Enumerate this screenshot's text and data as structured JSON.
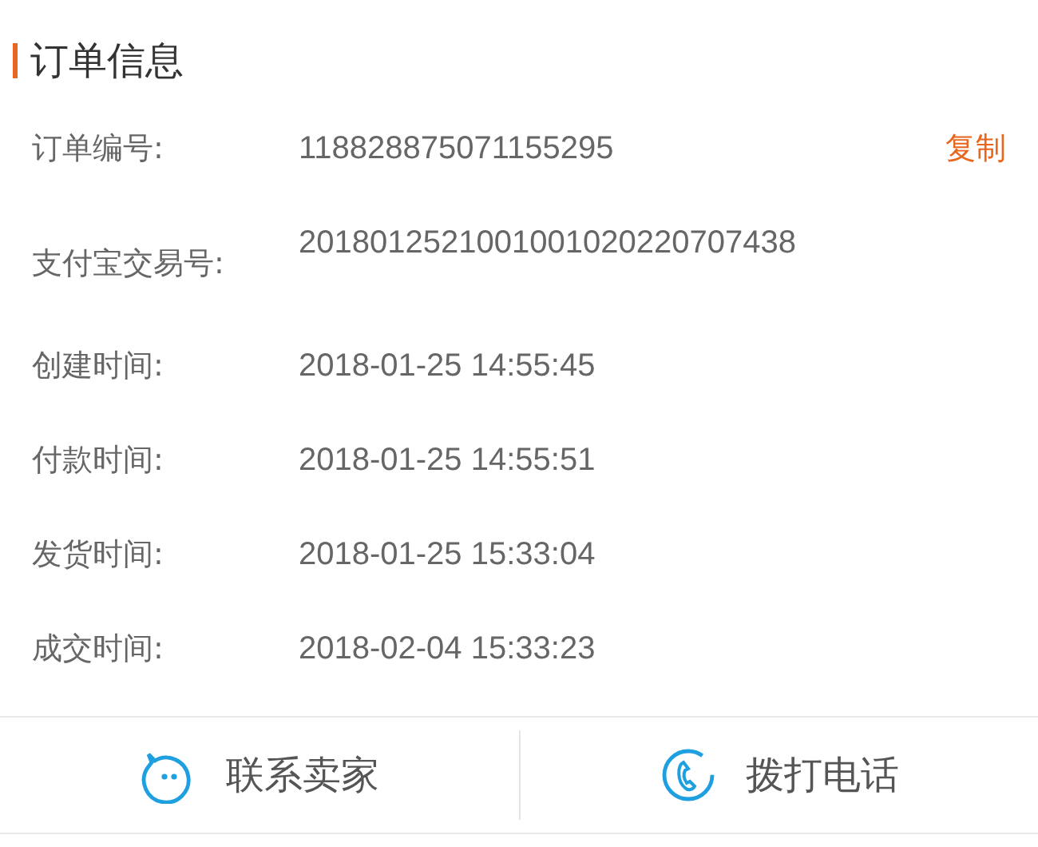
{
  "section": {
    "title": "订单信息"
  },
  "fields": [
    {
      "label": "订单编号:",
      "value": "118828875071155295",
      "action": "复制"
    },
    {
      "label": "支付宝交易号:",
      "value": "2018012521001001020220707438"
    },
    {
      "label": "创建时间:",
      "value": "2018-01-25 14:55:45"
    },
    {
      "label": "付款时间:",
      "value": "2018-01-25 14:55:51"
    },
    {
      "label": "发货时间:",
      "value": "2018-01-25 15:33:04"
    },
    {
      "label": "成交时间:",
      "value": "2018-02-04 15:33:23"
    }
  ],
  "buttons": [
    {
      "kind": "chat",
      "label": "联系卖家"
    },
    {
      "kind": "phone",
      "label": "拨打电话"
    }
  ]
}
